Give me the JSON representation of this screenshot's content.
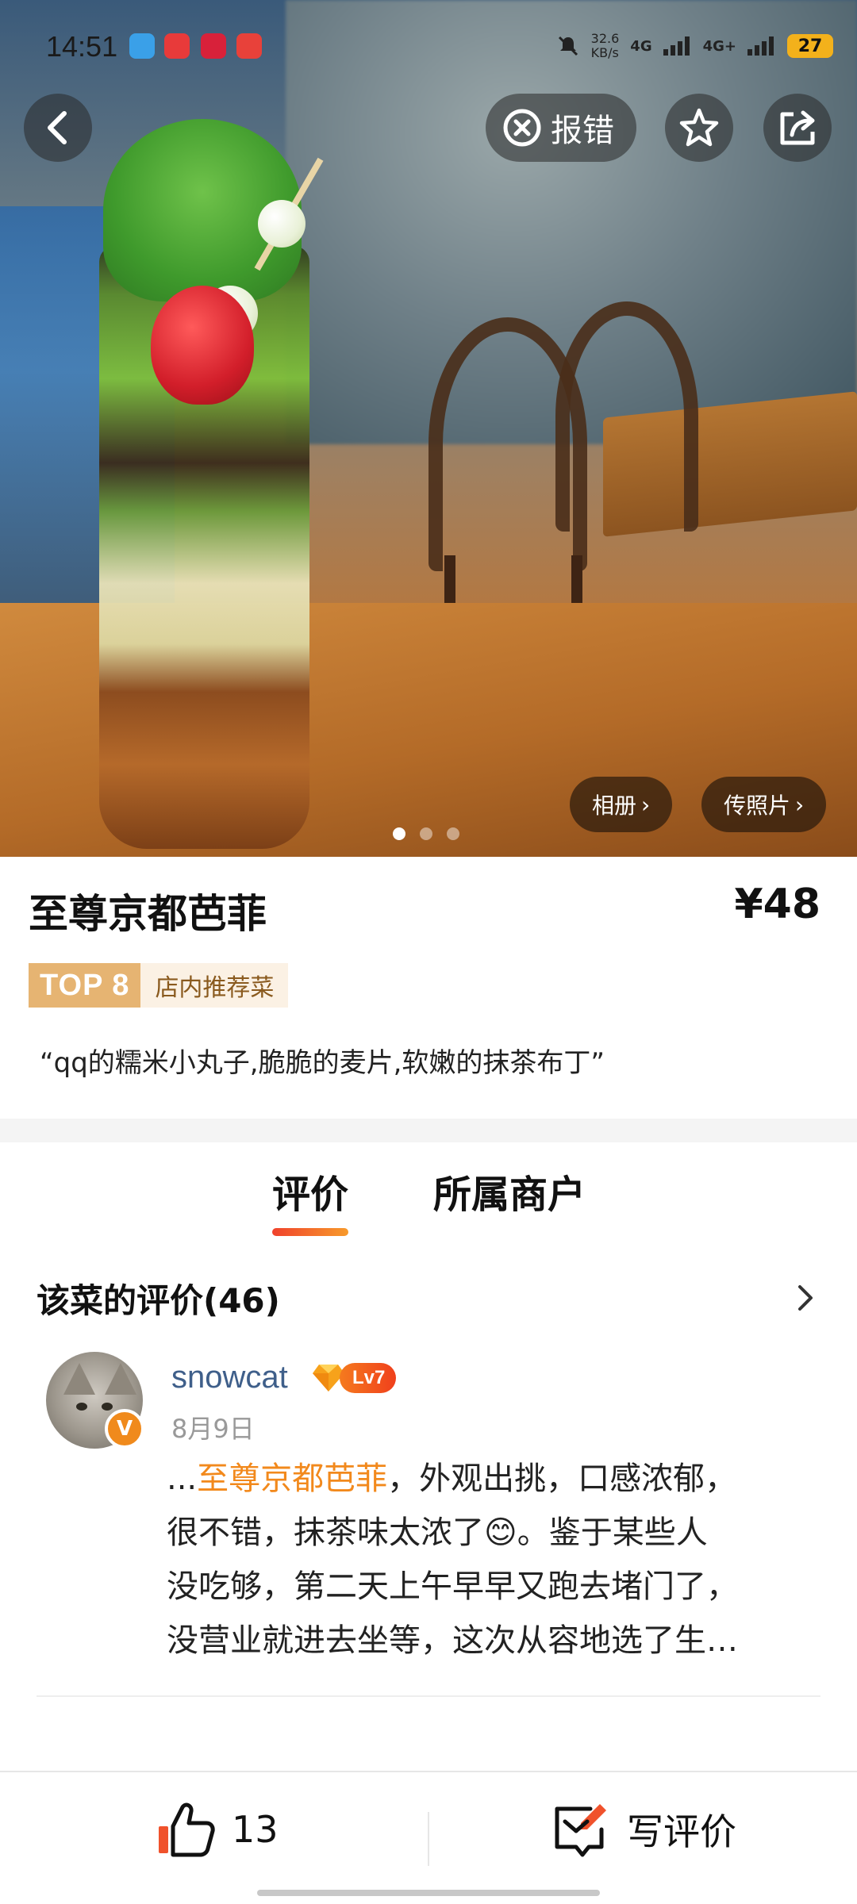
{
  "status_bar": {
    "time": "14:51",
    "net_speed": "32.6",
    "net_unit": "KB/s",
    "signal_1": "4G",
    "signal_2": "4G+",
    "battery": "27"
  },
  "hero": {
    "report_label": "报错",
    "album_label": "相册",
    "upload_label": "传照片",
    "carousel_total": 3,
    "carousel_active": 1
  },
  "dish": {
    "name": "至尊京都芭菲",
    "price": "¥48",
    "rank_label": "TOP 8",
    "tag": "店内推荐菜",
    "quote": "“qq的糯米小丸子,脆脆的麦片,软嫩的抹茶布丁”"
  },
  "tabs": [
    {
      "label": "评价",
      "active": true
    },
    {
      "label": "所属商户",
      "active": false
    }
  ],
  "reviews": {
    "header": "该菜的评价(46)",
    "items": [
      {
        "user": "snowcat",
        "level": "Lv7",
        "verified_badge": "V",
        "date": "8月9日",
        "prefix": "...",
        "highlight": "至尊京都芭菲",
        "text_1": "，外观出挑，口感浓郁，",
        "text_2": "很不错，抹茶味太浓了",
        "emoji": "😊",
        "text_3": "。鉴于某些人",
        "text_4": "没吃够，第二天上午早早又跑去堵门了，",
        "text_5": "没营业就进去坐等，这次从容地选了生…"
      }
    ]
  },
  "bottom_bar": {
    "like_count": "13",
    "write_label": "写评价"
  },
  "colors": {
    "accent_orange": "#f2891c",
    "tab_underline_start": "#f0422c",
    "tab_underline_end": "#f79a2b",
    "rank_gold": "#e6b472",
    "username_blue": "#3f5f8a"
  },
  "icons": [
    "back-icon",
    "report-icon",
    "star-icon",
    "share-icon",
    "chevron-right-icon",
    "thumbs-up-icon",
    "write-review-icon"
  ]
}
